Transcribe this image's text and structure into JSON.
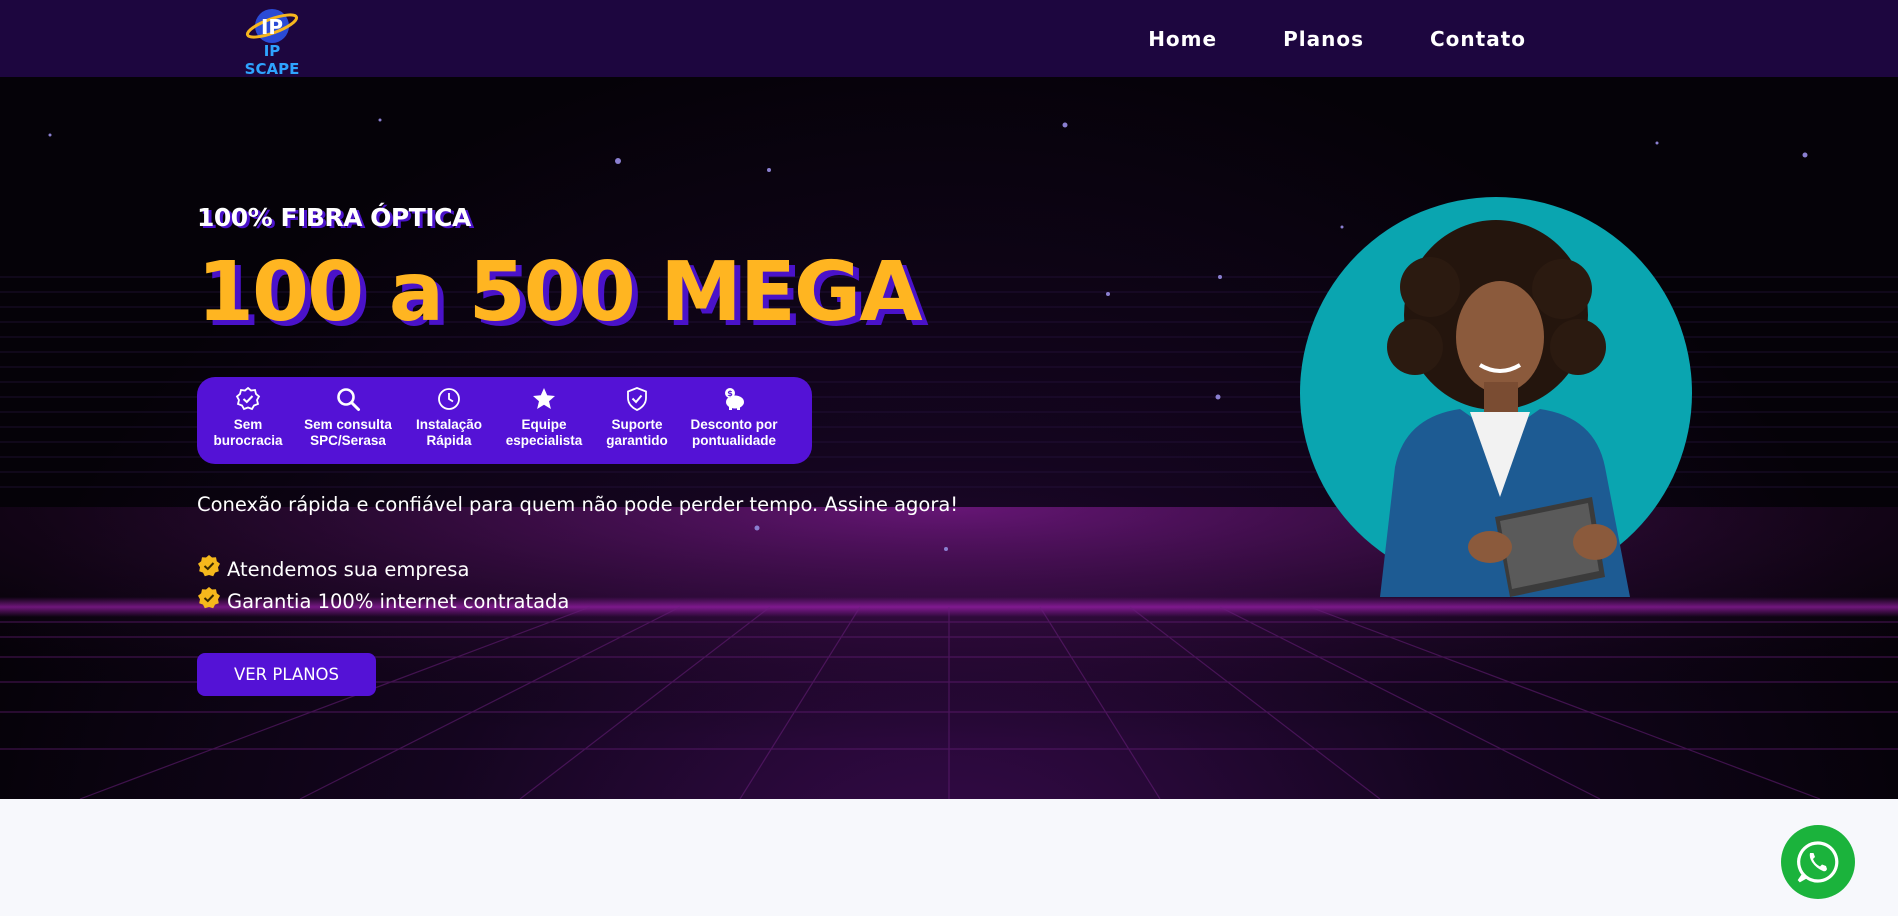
{
  "brand": {
    "logo_text": "IP SCAPE"
  },
  "nav": {
    "items": [
      {
        "label": "Home"
      },
      {
        "label": "Planos"
      },
      {
        "label": "Contato"
      }
    ]
  },
  "hero": {
    "kicker": "100% FIBRA ÓPTICA",
    "headline": "100 a 500 MEGA",
    "features": [
      {
        "icon": "badge-check-icon",
        "line1": "Sem",
        "line2": "burocracia"
      },
      {
        "icon": "search-icon",
        "line1": "Sem consulta",
        "line2": "SPC/Serasa"
      },
      {
        "icon": "clock-icon",
        "line1": "Instalação",
        "line2": "Rápida"
      },
      {
        "icon": "star-icon",
        "line1": "Equipe",
        "line2": "especialista"
      },
      {
        "icon": "shield-check-icon",
        "line1": "Suporte",
        "line2": "garantido"
      },
      {
        "icon": "piggy-bank-icon",
        "line1": "Desconto por",
        "line2": "pontualidade"
      }
    ],
    "tagline": "Conexão rápida e confiável para quem não pode perder tempo. Assine agora!",
    "checks": [
      {
        "text": "Atendemos sua empresa"
      },
      {
        "text": "Garantia 100% internet contratada"
      }
    ],
    "cta_label": "VER PLANOS"
  },
  "colors": {
    "nav_bg": "#1d063f",
    "accent_purple": "#5412d6",
    "headline_yellow": "#ffb521",
    "check_yellow": "#f5b81c",
    "whatsapp_green": "#1bb33c",
    "portrait_circle": "#0aa5b0"
  },
  "floating": {
    "whatsapp_icon": "whatsapp-icon"
  }
}
